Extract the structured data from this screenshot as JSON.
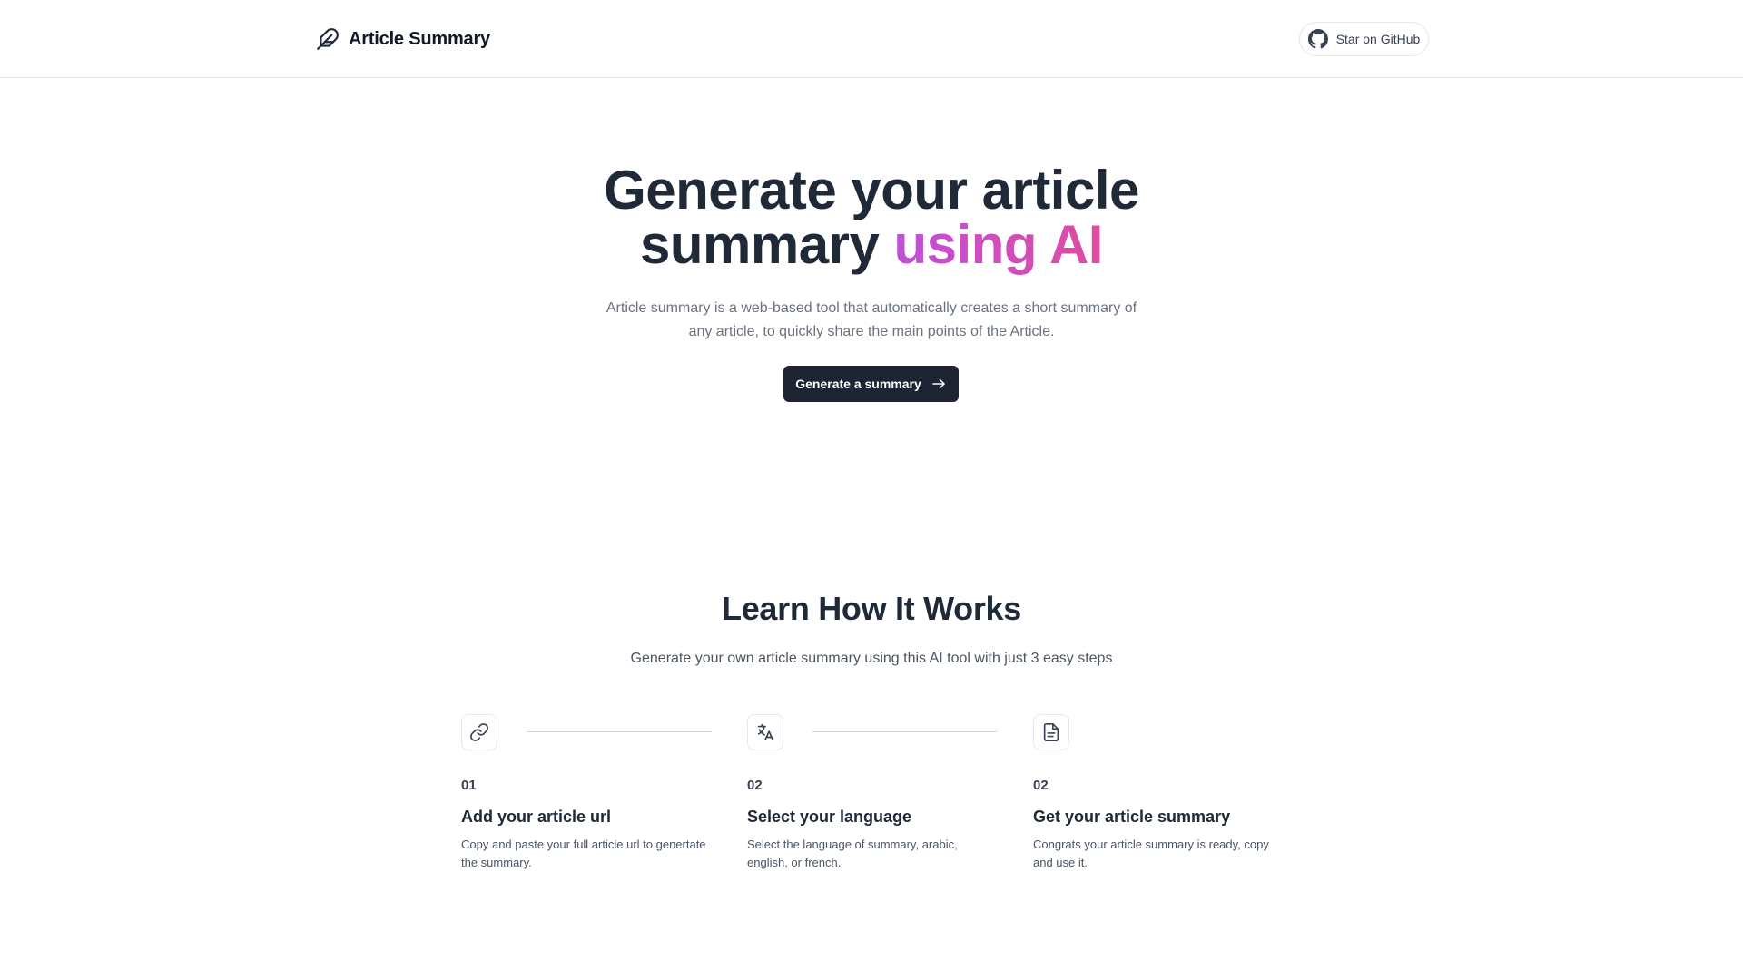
{
  "header": {
    "brand_name": "Article Summary",
    "brand_icon": "feather-icon",
    "github_button_label": "Star on GitHub",
    "github_icon": "github-icon"
  },
  "hero": {
    "title_line1": "Generate your article",
    "title_line2_plain": "summary ",
    "title_line2_accent": "using AI",
    "accent_gradient": [
      "#c04fd8",
      "#e04ca0"
    ],
    "subtitle": "Article summary is a web-based tool that automatically creates a short summary of any article, to quickly share the main points of the Article.",
    "cta_label": "Generate a summary",
    "cta_icon": "arrow-right-icon",
    "cta_color": "#1e2433"
  },
  "how": {
    "title": "Learn How It Works",
    "subtitle": "Generate your own article summary using this AI tool with just 3 easy steps",
    "steps": [
      {
        "icon": "link-icon",
        "number": "01",
        "title": "Add your article url",
        "description": "Copy and paste your full article url to genertate the summary."
      },
      {
        "icon": "translate-icon",
        "number": "02",
        "title": "Select your language",
        "description": "Select the language of summary, arabic, english, or french."
      },
      {
        "icon": "document-icon",
        "number": "02",
        "title": "Get your article summary",
        "description": "Congrats your article summary is ready, copy and use it."
      }
    ]
  }
}
